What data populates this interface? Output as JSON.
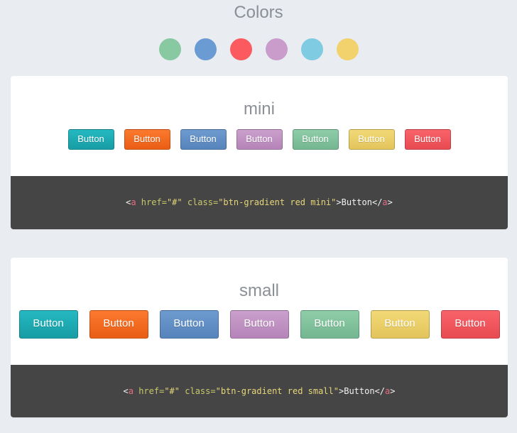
{
  "page": {
    "title": "Colors"
  },
  "palette": [
    "#88c9a1",
    "#6a9bd2",
    "#fb5a5e",
    "#c99ccc",
    "#7fcbe1",
    "#f1d26c"
  ],
  "buttons": [
    {
      "label": "Button",
      "color": "cyan",
      "top": "#25b9c1",
      "bottom": "#179ca4"
    },
    {
      "label": "Button",
      "color": "orange",
      "top": "#fb7a2f",
      "bottom": "#ea5d14"
    },
    {
      "label": "Button",
      "color": "blue",
      "top": "#6e9bcf",
      "bottom": "#5583bb"
    },
    {
      "label": "Button",
      "color": "purple",
      "top": "#caa0cc",
      "bottom": "#b583b8"
    },
    {
      "label": "Button",
      "color": "green",
      "top": "#8fcda8",
      "bottom": "#73b690"
    },
    {
      "label": "Button",
      "color": "yellow",
      "top": "#f2d977",
      "bottom": "#e3c45b"
    },
    {
      "label": "Button",
      "color": "red",
      "top": "#f9636a",
      "bottom": "#e84a51"
    }
  ],
  "sections": {
    "mini": {
      "heading": "mini",
      "code": {
        "lt": "<",
        "tag": "a",
        "href_attr": " href=",
        "href_val": "\"#\"",
        "class_attr": " class=",
        "class_val": "\"btn-gradient red mini\"",
        "gt": ">",
        "text": "Button",
        "close_lt": "</",
        "close_tag": "a",
        "close_gt": ">"
      }
    },
    "small": {
      "heading": "small",
      "code": {
        "lt": "<",
        "tag": "a",
        "href_attr": " href=",
        "href_val": "\"#\"",
        "class_attr": " class=",
        "class_val": "\"btn-gradient red small\"",
        "gt": ">",
        "text": "Button",
        "close_lt": "</",
        "close_tag": "a",
        "close_gt": ">"
      }
    }
  }
}
